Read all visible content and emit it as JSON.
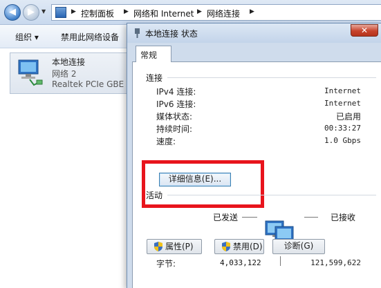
{
  "explorer": {
    "breadcrumbs": [
      "控制面板",
      "网络和 Internet",
      "网络连接"
    ],
    "toolbar": {
      "organize": "组织 ▾",
      "disable": "禁用此网络设备"
    },
    "adapter": {
      "name": "本地连接",
      "network": "网络  2",
      "device": "Realtek PCIe GBE"
    }
  },
  "dialog": {
    "title": "本地连接 状态",
    "close": "✕",
    "tab": "常规",
    "connection": {
      "label": "连接",
      "rows": [
        {
          "label": "IPv4 连接:",
          "value": "Internet"
        },
        {
          "label": "IPv6 连接:",
          "value": "Internet"
        },
        {
          "label": "媒体状态:",
          "value": "已启用"
        },
        {
          "label": "持续时间:",
          "value": "00:33:27"
        },
        {
          "label": "速度:",
          "value": "1.0 Gbps"
        }
      ],
      "details_button": "详细信息(E)..."
    },
    "activity": {
      "label": "活动",
      "sent_label": "已发送",
      "received_label": "已接收",
      "bytes_label": "字节:",
      "bytes_sent": "4,033,122",
      "bytes_received": "121,599,622"
    },
    "buttons": {
      "properties": "属性(P)",
      "disable": "禁用(D)",
      "diagnose": "诊断(G)"
    }
  },
  "colors": {
    "highlight": "#e8141c",
    "title_bar": "#c3d4ea",
    "accent": "#3c7fb1"
  }
}
